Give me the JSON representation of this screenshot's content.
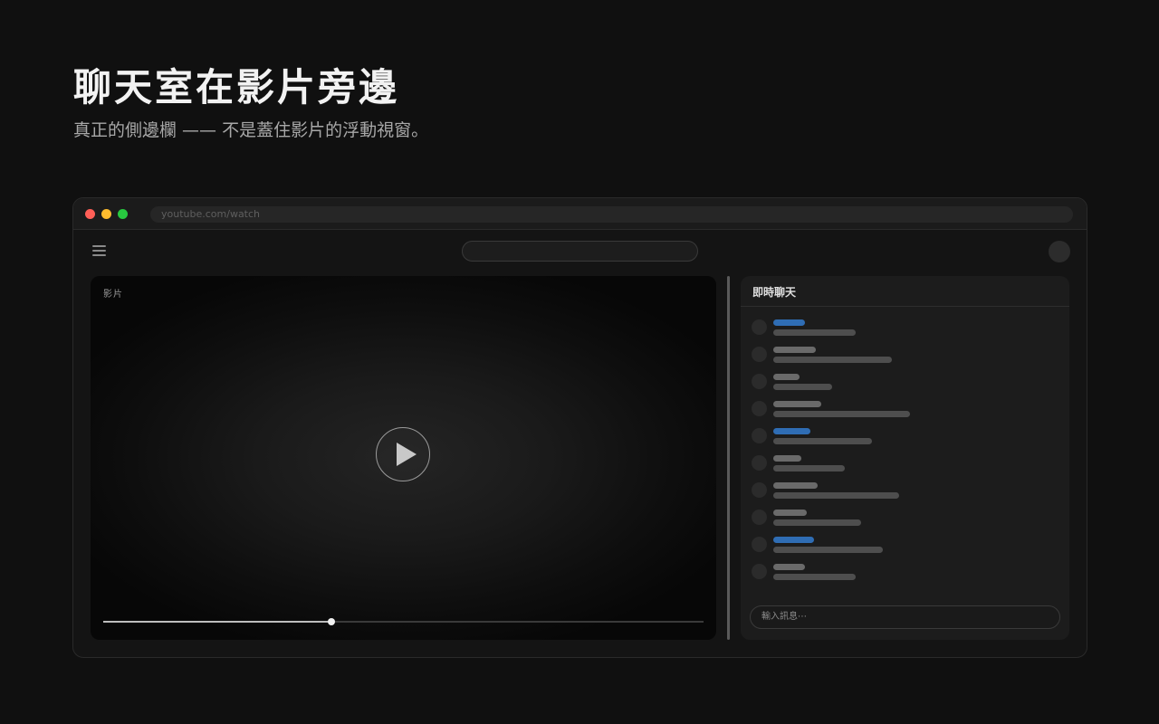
{
  "hero": {
    "title": "聊天室在影片旁邊",
    "subtitle": "真正的側邊欄 —— 不是蓋住影片的浮動視窗。"
  },
  "browser": {
    "url": "youtube.com/watch",
    "traffic_lights": [
      "#ff5f57",
      "#febc2e",
      "#28c840"
    ]
  },
  "youtube": {
    "menu_icon": "hamburger-icon",
    "search_placeholder": "",
    "avatar_icon": "avatar"
  },
  "player": {
    "label": "影片",
    "play_icon": "play-icon",
    "progress": 0.38
  },
  "chat": {
    "title": "即時聊天",
    "input_placeholder": "輸入訊息⋯",
    "accent_color": "#2f6db4",
    "messages": [
      {
        "highlighted": true
      },
      {
        "highlighted": false
      },
      {
        "highlighted": false
      },
      {
        "highlighted": false
      },
      {
        "highlighted": true
      },
      {
        "highlighted": false
      },
      {
        "highlighted": false
      },
      {
        "highlighted": false
      },
      {
        "highlighted": true
      },
      {
        "highlighted": false
      }
    ]
  }
}
